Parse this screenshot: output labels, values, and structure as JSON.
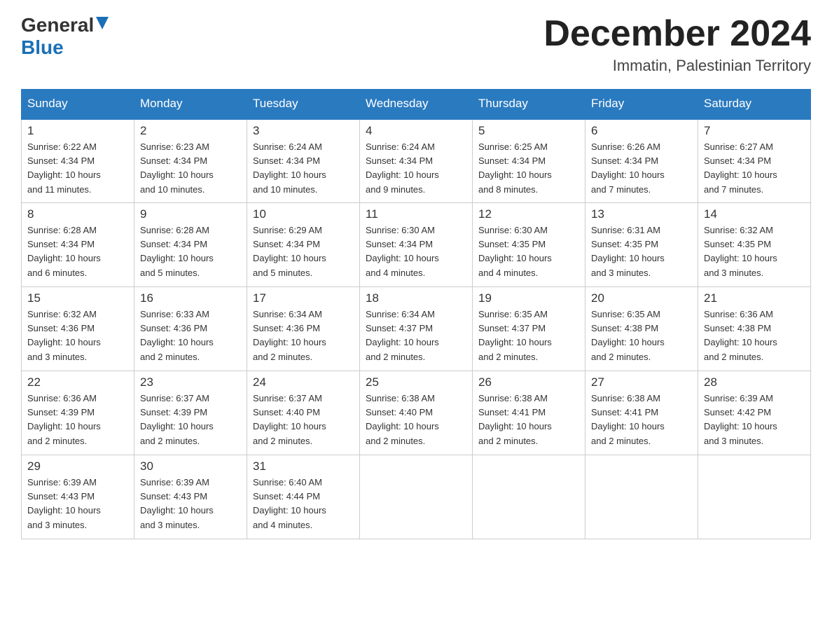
{
  "header": {
    "logo_general": "General",
    "logo_blue": "Blue",
    "title": "December 2024",
    "location": "Immatin, Palestinian Territory"
  },
  "days_of_week": [
    "Sunday",
    "Monday",
    "Tuesday",
    "Wednesday",
    "Thursday",
    "Friday",
    "Saturday"
  ],
  "weeks": [
    [
      {
        "day": "1",
        "sunrise": "6:22 AM",
        "sunset": "4:34 PM",
        "daylight": "10 hours and 11 minutes."
      },
      {
        "day": "2",
        "sunrise": "6:23 AM",
        "sunset": "4:34 PM",
        "daylight": "10 hours and 10 minutes."
      },
      {
        "day": "3",
        "sunrise": "6:24 AM",
        "sunset": "4:34 PM",
        "daylight": "10 hours and 10 minutes."
      },
      {
        "day": "4",
        "sunrise": "6:24 AM",
        "sunset": "4:34 PM",
        "daylight": "10 hours and 9 minutes."
      },
      {
        "day": "5",
        "sunrise": "6:25 AM",
        "sunset": "4:34 PM",
        "daylight": "10 hours and 8 minutes."
      },
      {
        "day": "6",
        "sunrise": "6:26 AM",
        "sunset": "4:34 PM",
        "daylight": "10 hours and 7 minutes."
      },
      {
        "day": "7",
        "sunrise": "6:27 AM",
        "sunset": "4:34 PM",
        "daylight": "10 hours and 7 minutes."
      }
    ],
    [
      {
        "day": "8",
        "sunrise": "6:28 AM",
        "sunset": "4:34 PM",
        "daylight": "10 hours and 6 minutes."
      },
      {
        "day": "9",
        "sunrise": "6:28 AM",
        "sunset": "4:34 PM",
        "daylight": "10 hours and 5 minutes."
      },
      {
        "day": "10",
        "sunrise": "6:29 AM",
        "sunset": "4:34 PM",
        "daylight": "10 hours and 5 minutes."
      },
      {
        "day": "11",
        "sunrise": "6:30 AM",
        "sunset": "4:34 PM",
        "daylight": "10 hours and 4 minutes."
      },
      {
        "day": "12",
        "sunrise": "6:30 AM",
        "sunset": "4:35 PM",
        "daylight": "10 hours and 4 minutes."
      },
      {
        "day": "13",
        "sunrise": "6:31 AM",
        "sunset": "4:35 PM",
        "daylight": "10 hours and 3 minutes."
      },
      {
        "day": "14",
        "sunrise": "6:32 AM",
        "sunset": "4:35 PM",
        "daylight": "10 hours and 3 minutes."
      }
    ],
    [
      {
        "day": "15",
        "sunrise": "6:32 AM",
        "sunset": "4:36 PM",
        "daylight": "10 hours and 3 minutes."
      },
      {
        "day": "16",
        "sunrise": "6:33 AM",
        "sunset": "4:36 PM",
        "daylight": "10 hours and 2 minutes."
      },
      {
        "day": "17",
        "sunrise": "6:34 AM",
        "sunset": "4:36 PM",
        "daylight": "10 hours and 2 minutes."
      },
      {
        "day": "18",
        "sunrise": "6:34 AM",
        "sunset": "4:37 PM",
        "daylight": "10 hours and 2 minutes."
      },
      {
        "day": "19",
        "sunrise": "6:35 AM",
        "sunset": "4:37 PM",
        "daylight": "10 hours and 2 minutes."
      },
      {
        "day": "20",
        "sunrise": "6:35 AM",
        "sunset": "4:38 PM",
        "daylight": "10 hours and 2 minutes."
      },
      {
        "day": "21",
        "sunrise": "6:36 AM",
        "sunset": "4:38 PM",
        "daylight": "10 hours and 2 minutes."
      }
    ],
    [
      {
        "day": "22",
        "sunrise": "6:36 AM",
        "sunset": "4:39 PM",
        "daylight": "10 hours and 2 minutes."
      },
      {
        "day": "23",
        "sunrise": "6:37 AM",
        "sunset": "4:39 PM",
        "daylight": "10 hours and 2 minutes."
      },
      {
        "day": "24",
        "sunrise": "6:37 AM",
        "sunset": "4:40 PM",
        "daylight": "10 hours and 2 minutes."
      },
      {
        "day": "25",
        "sunrise": "6:38 AM",
        "sunset": "4:40 PM",
        "daylight": "10 hours and 2 minutes."
      },
      {
        "day": "26",
        "sunrise": "6:38 AM",
        "sunset": "4:41 PM",
        "daylight": "10 hours and 2 minutes."
      },
      {
        "day": "27",
        "sunrise": "6:38 AM",
        "sunset": "4:41 PM",
        "daylight": "10 hours and 2 minutes."
      },
      {
        "day": "28",
        "sunrise": "6:39 AM",
        "sunset": "4:42 PM",
        "daylight": "10 hours and 3 minutes."
      }
    ],
    [
      {
        "day": "29",
        "sunrise": "6:39 AM",
        "sunset": "4:43 PM",
        "daylight": "10 hours and 3 minutes."
      },
      {
        "day": "30",
        "sunrise": "6:39 AM",
        "sunset": "4:43 PM",
        "daylight": "10 hours and 3 minutes."
      },
      {
        "day": "31",
        "sunrise": "6:40 AM",
        "sunset": "4:44 PM",
        "daylight": "10 hours and 4 minutes."
      },
      null,
      null,
      null,
      null
    ]
  ],
  "labels": {
    "sunrise": "Sunrise:",
    "sunset": "Sunset:",
    "daylight": "Daylight:"
  }
}
